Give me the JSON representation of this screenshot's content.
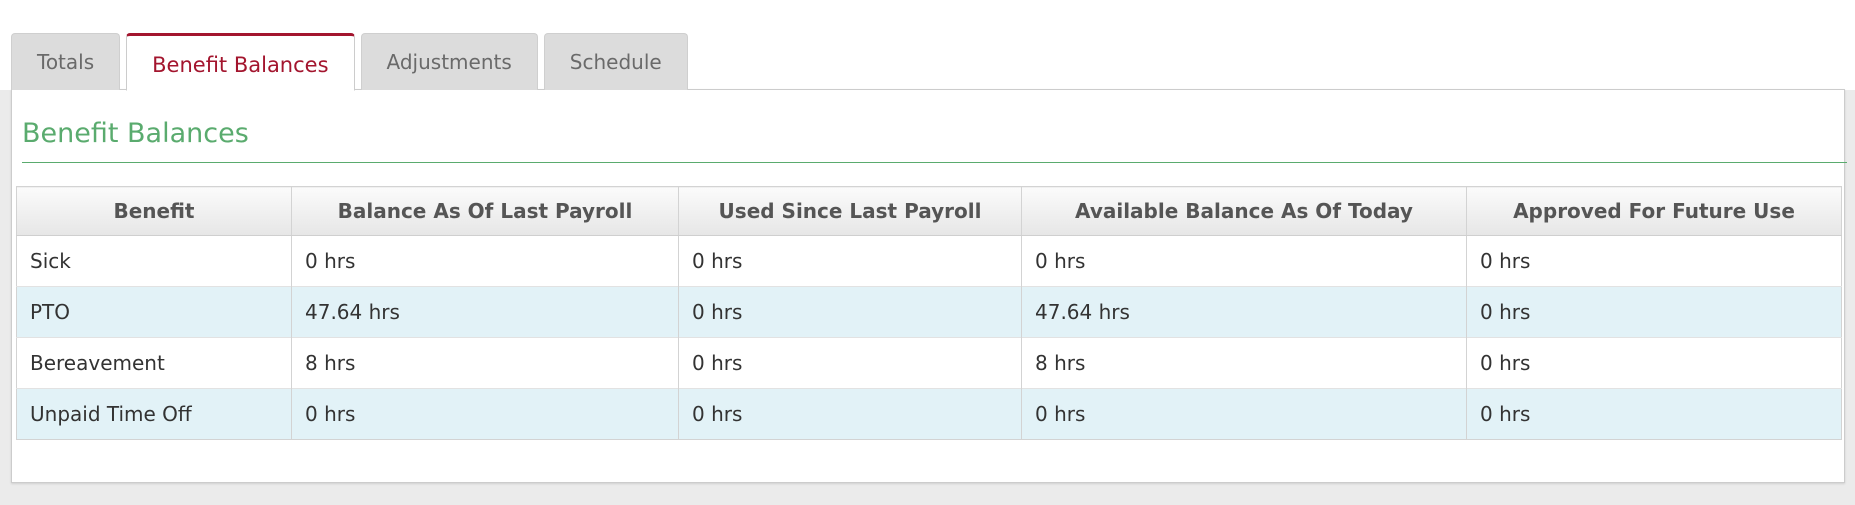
{
  "tabs": [
    {
      "label": "Totals"
    },
    {
      "label": "Benefit Balances"
    },
    {
      "label": "Adjustments"
    },
    {
      "label": "Schedule"
    }
  ],
  "active_tab": "Benefit Balances",
  "section": {
    "title": "Benefit Balances"
  },
  "table": {
    "headers": [
      "Benefit",
      "Balance As Of Last Payroll",
      "Used Since Last Payroll",
      "Available Balance As Of Today",
      "Approved For Future Use"
    ],
    "rows": [
      {
        "benefit": "Sick",
        "last_payroll": "0 hrs",
        "used": "0 hrs",
        "available": "0 hrs",
        "approved": "0 hrs"
      },
      {
        "benefit": "PTO",
        "last_payroll": "47.64 hrs",
        "used": "0 hrs",
        "available": "47.64 hrs",
        "approved": "0 hrs"
      },
      {
        "benefit": "Bereavement",
        "last_payroll": "8 hrs",
        "used": "0 hrs",
        "available": "8 hrs",
        "approved": "0 hrs"
      },
      {
        "benefit": "Unpaid Time Off",
        "last_payroll": "0 hrs",
        "used": "0 hrs",
        "available": "0 hrs",
        "approved": "0 hrs"
      }
    ]
  },
  "colors": {
    "accent": "#a3152e",
    "section_title": "#5aab6e",
    "alt_row": "#e2f2f7"
  }
}
